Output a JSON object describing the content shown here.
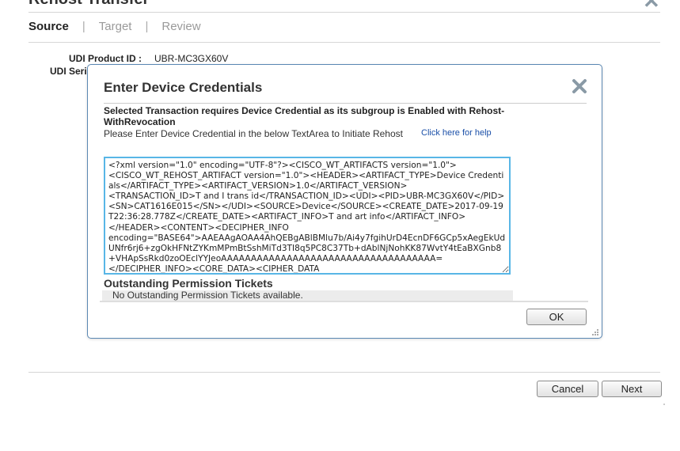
{
  "page": {
    "title": "Rehost Transfer",
    "steps": [
      {
        "label": "Source",
        "active": true
      },
      {
        "label": "Target",
        "active": false
      },
      {
        "label": "Review",
        "active": false
      }
    ],
    "step_separator": "|",
    "fields": [
      {
        "label": "UDI Product ID :",
        "value": "UBR-MC3GX60V"
      },
      {
        "label": "UDI Seri",
        "value": ""
      }
    ],
    "cancel_label": "Cancel",
    "next_label": "Next"
  },
  "modal": {
    "title": "Enter Device Credentials",
    "message_bold": "Selected Transaction requires Device Credential as its subgroup is Enabled with Rehost-WithRevocation",
    "message": "Please Enter Device Credential in the below TextArea to Initiate Rehost",
    "help_link": "Click here for help",
    "credential_text": "<?xml version=\"1.0\" encoding=\"UTF-8\"?><CISCO_WT_ARTIFACTS version=\"1.0\">\n<CISCO_WT_REHOST_ARTIFACT version=\"1.0\"><HEADER><ARTIFACT_TYPE>Device Credentials</ARTIFACT_TYPE><ARTIFACT_VERSION>1.0</ARTIFACT_VERSION>\n<TRANSACTION_ID>T and I trans id</TRANSACTION_ID><UDI><PID>UBR-MC3GX60V</PID>\n<SN>CAT1616E015</SN></UDI><SOURCE>Device</SOURCE><CREATE_DATE>2017-09-19T22:36:28.778Z</CREATE_DATE><ARTIFACT_INFO>T and art info</ARTIFACT_INFO>\n</HEADER><CONTENT><DECIPHER_INFO\nencoding=\"BASE64\">AAEAAgAOAA4AhQEBgABlBMlu7b/Ai4y7fgihUrD4EcnDF6GCp5xAegEkUdUNfr6rj6+zgOkHFNtZYKmMPmBtSshMiTd3TI8q5PC8C37Tb+dAblNjNohKK87WvtY4tEaBXGnb8+VHApSsRkd0zoOEclYYJeoAAAAAAAAAAAAAAAAAAAAAAAAAAAAAAAAAAAA=\n</DECIPHER_INFO><CORE_DATA><CIPHER_DATA",
    "tickets_title": "Outstanding Permission Tickets",
    "tickets_empty": "No Outstanding Permission Tickets available.",
    "ok_label": "OK"
  },
  "icons": {
    "close": "close-x-icon",
    "resize": "resize-grip-icon"
  },
  "colors": {
    "modal_border": "#5b88b3",
    "textarea_focus": "#58b6e6",
    "link": "#1a4fa8",
    "close_icon": "#8a9aa6"
  }
}
